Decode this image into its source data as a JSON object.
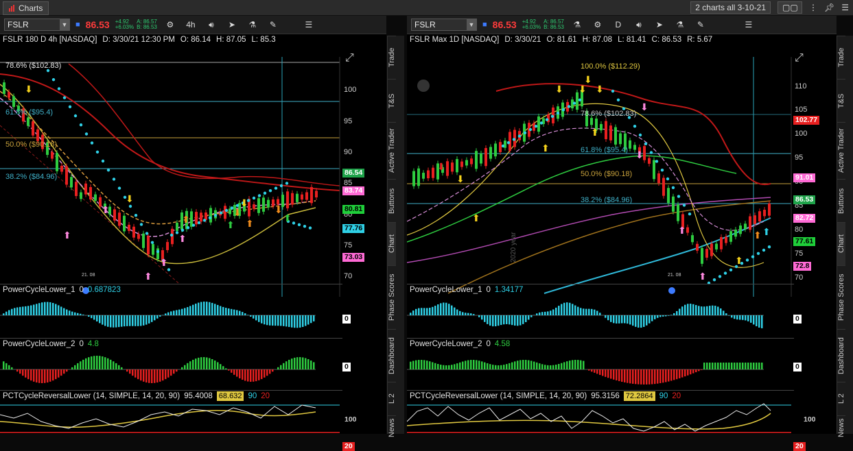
{
  "window": {
    "tab_label": "Charts",
    "grid_label": "2 charts all 3-10-21"
  },
  "left": {
    "symbol": "FSLR",
    "price": "86.53",
    "chg1": "+4.92",
    "chg2": "+6.03%",
    "chg3": "A: 86.57",
    "chg4": "B: 86.53",
    "interval": "4h",
    "header": {
      "title": "FSLR 180 D 4h [NASDAQ]",
      "date": "D: 3/30/21 12:30 PM",
      "o": "O: 86.14",
      "h": "H: 87.05",
      "l": "L: 85.3"
    },
    "fib": {
      "f786": "78.6% ($102.83)",
      "f618": "61.8% ($95.4)",
      "f500": "50.0% ($90.18)",
      "f382": "38.2% ($84.96)"
    },
    "axis": [
      "100",
      "95",
      "90",
      "85",
      "80",
      "75",
      "70"
    ],
    "badges": {
      "b1": "86.54",
      "b2": "83.74",
      "b3": "80.81",
      "b4": "77.76",
      "b5": "73.03"
    },
    "ind1": {
      "name": "PowerCycleLower_1",
      "zero": "0",
      "val": "0.687823",
      "axis": "0"
    },
    "ind2": {
      "name": "PowerCycleLower_2",
      "zero": "0",
      "val": "4.8",
      "axis": "0"
    },
    "ind3": {
      "name": "PCTCycleReversalLower (14, SIMPLE, 14, 20, 90)",
      "v1": "95.4008",
      "v2": "68.632",
      "v3": "90",
      "v4": "20",
      "top": "100",
      "bot": "20"
    },
    "event_label": "21. 08"
  },
  "right": {
    "symbol": "FSLR",
    "price": "86.53",
    "chg1": "+4.92",
    "chg2": "+6.03%",
    "chg3": "A: 86.57",
    "chg4": "B: 86.53",
    "interval": "D",
    "header": {
      "title": "FSLR Max 1D [NASDAQ]",
      "date": "D: 3/30/21",
      "o": "O: 81.61",
      "h": "H: 87.08",
      "l": "L: 81.41",
      "c": "C: 86.53",
      "r": "R: 5.67"
    },
    "fib": {
      "f100": "100.0% ($112.29)",
      "f786": "78.6% ($102.83)",
      "f618": "61.8% ($95.4)",
      "f500": "50.0% ($90.18)",
      "f382": "38.2% ($84.96)"
    },
    "axis": [
      "110",
      "105",
      "100",
      "95",
      "90",
      "85",
      "80",
      "75",
      "70"
    ],
    "badges": {
      "b1": "102.77",
      "b2": "91.01",
      "b3": "86.53",
      "b4": "82.72",
      "b5": "77.61",
      "b6": "72.8"
    },
    "year_label": "2020 year",
    "ind1": {
      "name": "PowerCycleLower_1",
      "zero": "0",
      "val": "1.34177",
      "axis": "0"
    },
    "ind2": {
      "name": "PowerCycleLower_2",
      "zero": "0",
      "val": "4.58",
      "axis": "0"
    },
    "ind3": {
      "name": "PCTCycleReversalLower (14, SIMPLE, 14, 20, 90)",
      "v1": "95.3156",
      "v2": "72.2864",
      "v3": "90",
      "v4": "20",
      "top": "100",
      "bot": "20"
    },
    "event_label": "21. 08"
  },
  "side_tabs": [
    "Trade",
    "T&S",
    "Active Trader",
    "Buttons",
    "Chart",
    "Phase Scores",
    "Dashboard",
    "L 2",
    "News"
  ],
  "colors": {
    "up": "#2ecc40",
    "down": "#e82020",
    "cyan": "#2fd0e6",
    "pink": "#ff6ad5"
  }
}
